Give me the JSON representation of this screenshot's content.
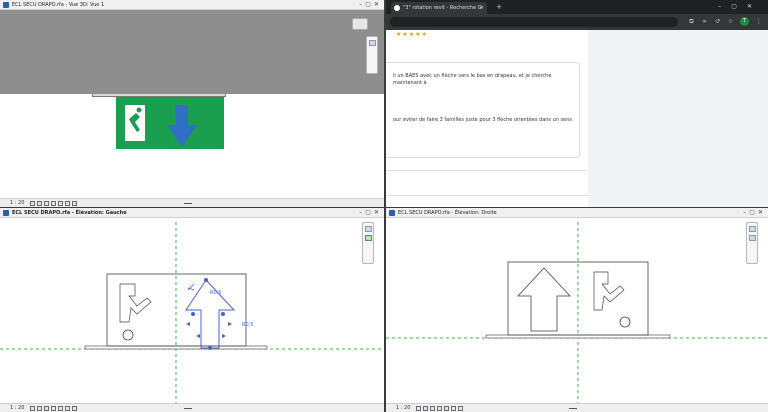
{
  "windows": {
    "view3d": {
      "title": "ECL SECU DRAPO.rfa - Vue 3D: Vue 1",
      "scale": "1 : 20"
    },
    "left_elev": {
      "title": "ECL SECU DRAPO.rfa - Élévation: Gauche",
      "scale": "1 : 20"
    },
    "right_elev": {
      "title": "ECL SECU DRAPO.rfa - Élévation: Droite",
      "scale": "1 : 20"
    },
    "browser": {
      "tab_title": "\"3\" rotation revit - Recherche G",
      "tab_close": "×",
      "new_tab": "+",
      "window_controls": "–▢✕",
      "avatar": "T",
      "post_line_1": "li un BAES avec un flèche vers le bas en drapeau, et je cherche maintenant à",
      "post_line_2": "our éviter de faire 3 familles juste pour 3 flèche orientées dans un sens",
      "stars": "★★★★★"
    }
  },
  "annotations": {
    "dim_top": "R0,5",
    "dim_side": "R0,5"
  },
  "colors": {
    "sign_green": "#1a9e4f",
    "arrow_blue": "#2f6fc4",
    "grid_green": "#3bb04a",
    "grip_blue": "#4b5fd0"
  }
}
